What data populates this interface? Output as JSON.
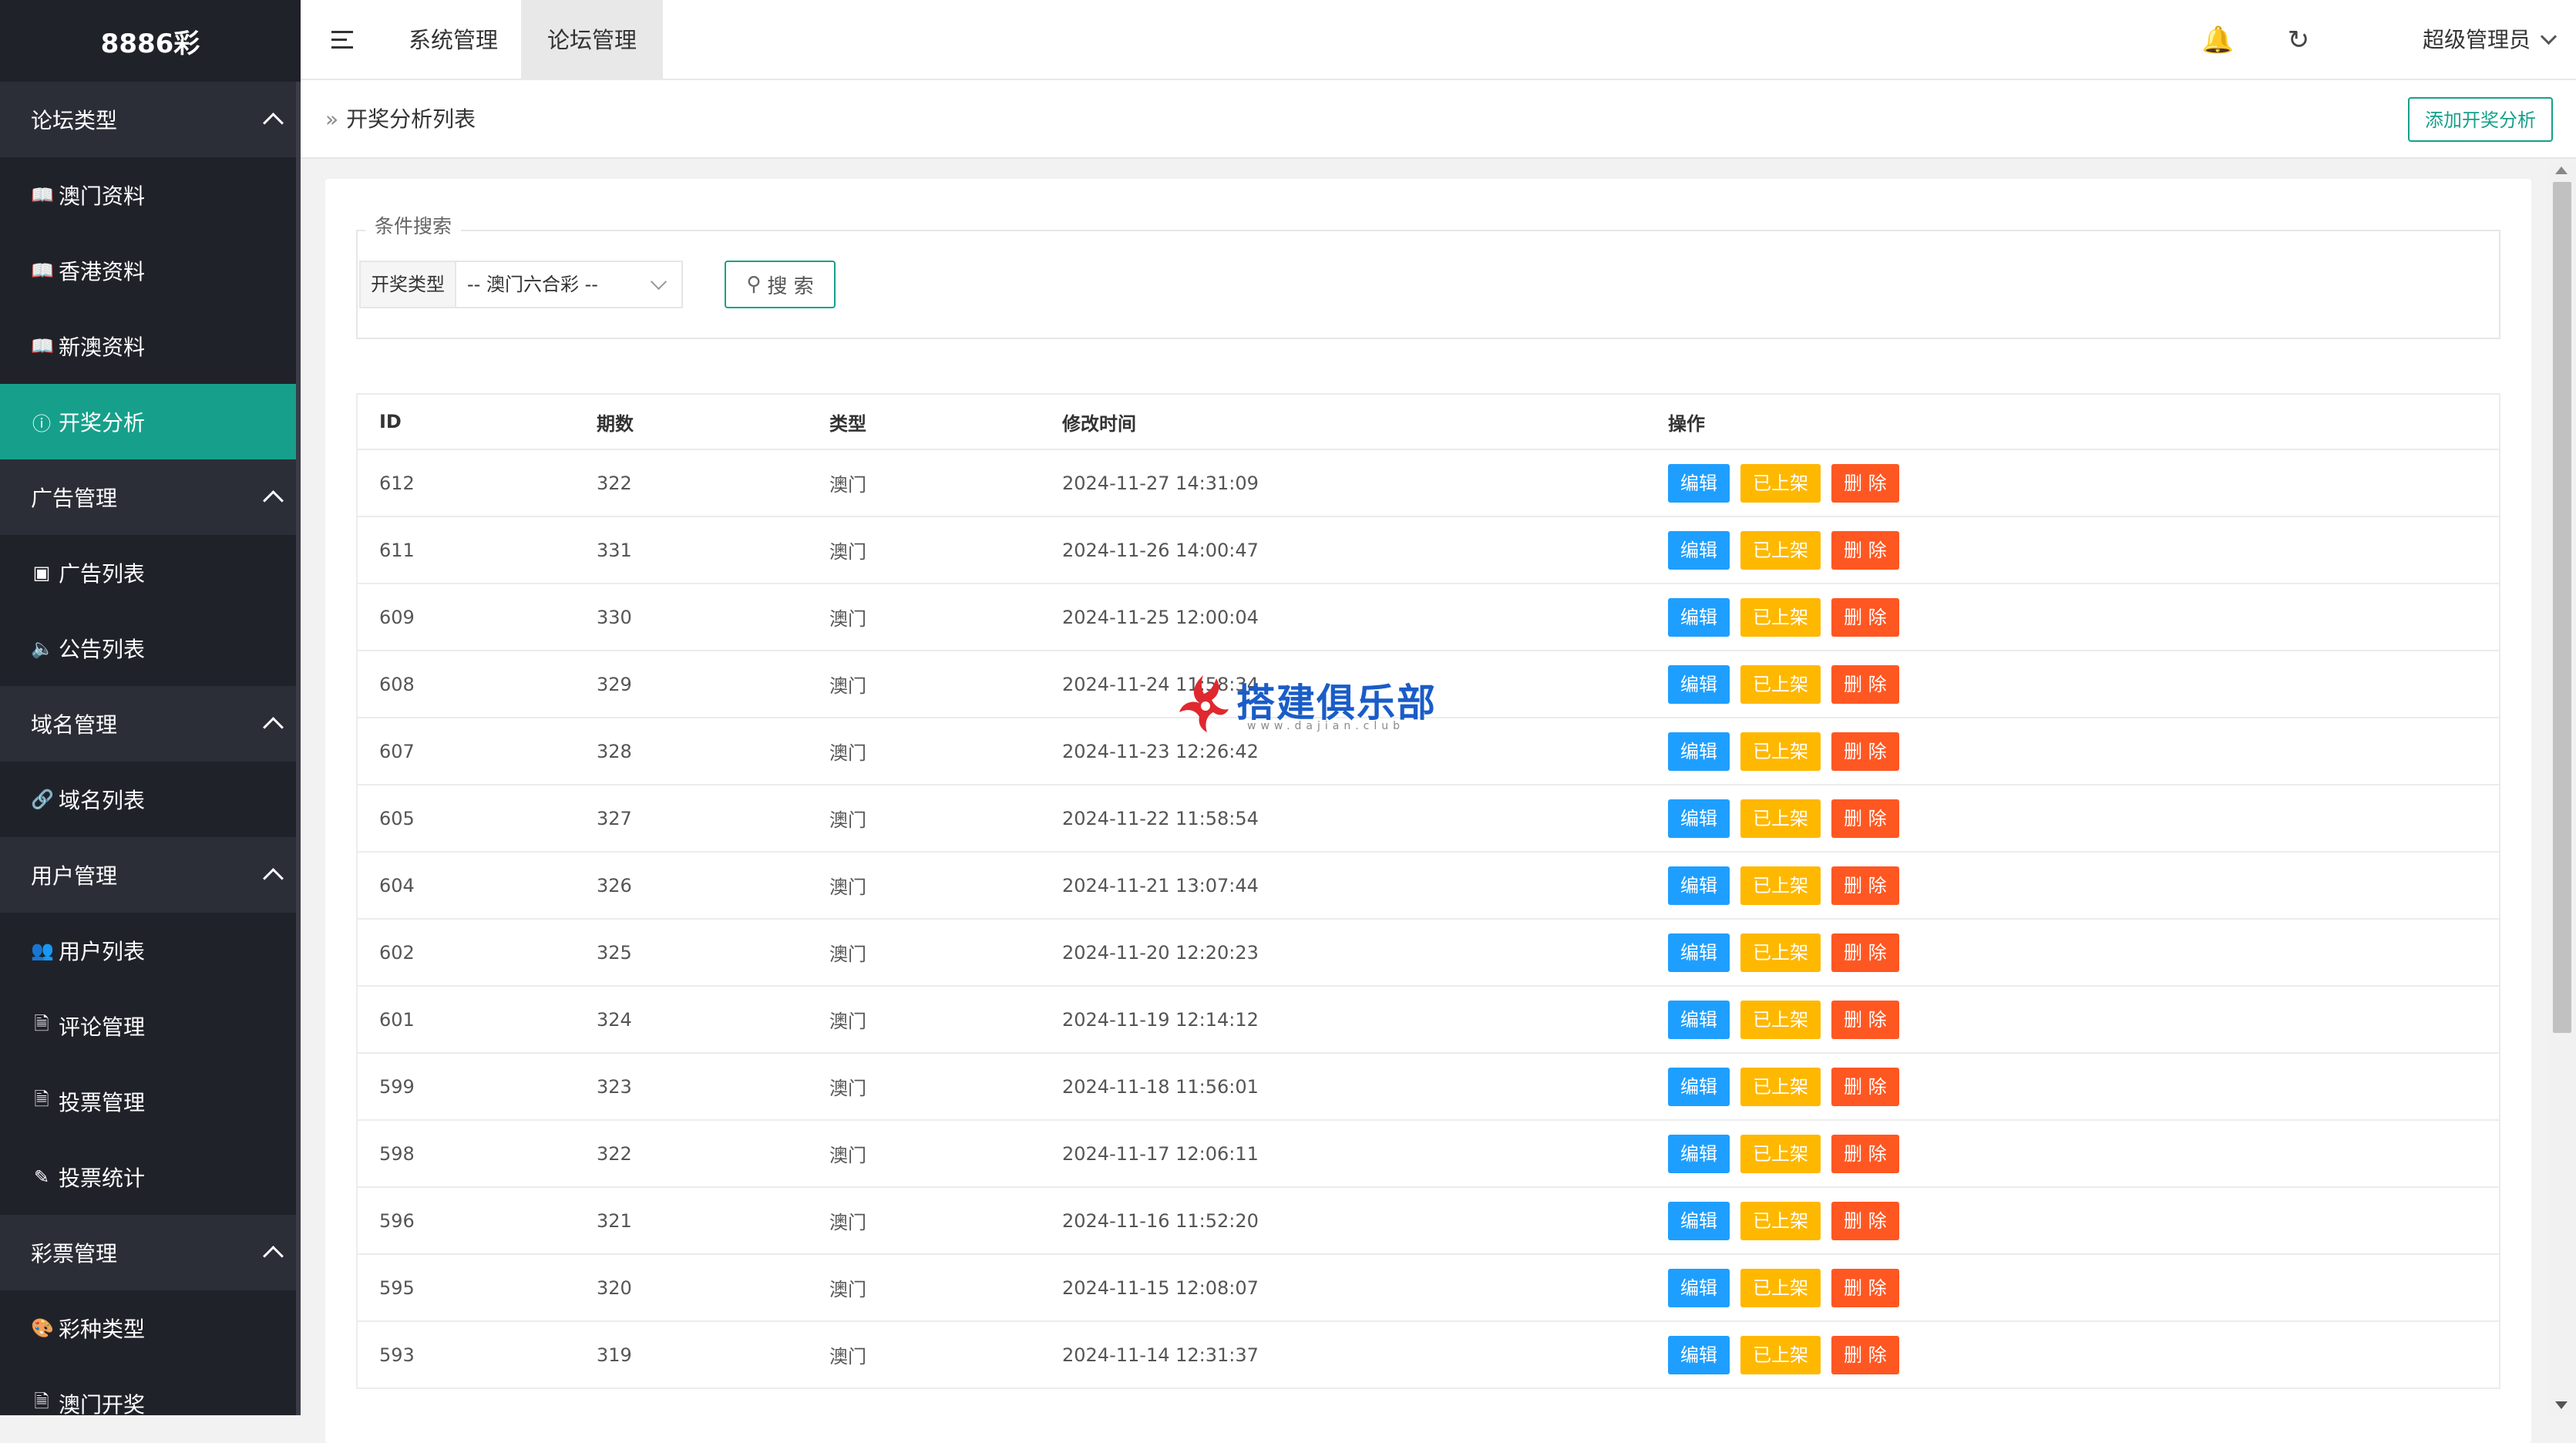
{
  "sidebar": {
    "brand": "8886彩",
    "sections": [
      {
        "label": "论坛类型",
        "items": [
          {
            "label": "澳门资料",
            "icon": "book-icon"
          },
          {
            "label": "香港资料",
            "icon": "book-icon"
          },
          {
            "label": "新澳资料",
            "icon": "book-icon"
          },
          {
            "label": "开奖分析",
            "icon": "help-circle-icon",
            "active": true
          }
        ]
      },
      {
        "label": "广告管理",
        "items": [
          {
            "label": "广告列表",
            "icon": "picture-icon"
          },
          {
            "label": "公告列表",
            "icon": "speaker-icon"
          }
        ]
      },
      {
        "label": "域名管理",
        "items": [
          {
            "label": "域名列表",
            "icon": "link-icon"
          }
        ]
      },
      {
        "label": "用户管理",
        "items": [
          {
            "label": "用户列表",
            "icon": "users-icon"
          },
          {
            "label": "评论管理",
            "icon": "document-icon"
          },
          {
            "label": "投票管理",
            "icon": "document-icon"
          },
          {
            "label": "投票统计",
            "icon": "edit-document-icon"
          }
        ]
      },
      {
        "label": "彩票管理",
        "items": [
          {
            "label": "彩种类型",
            "icon": "palette-icon"
          },
          {
            "label": "澳门开奖",
            "icon": "document-icon"
          }
        ]
      }
    ]
  },
  "header": {
    "tabs": [
      {
        "label": "系统管理",
        "active": false
      },
      {
        "label": "论坛管理",
        "active": true
      }
    ],
    "user": "超级管理员"
  },
  "breadcrumb": {
    "current": "开奖分析列表"
  },
  "add_button": "添加开奖分析",
  "search": {
    "legend": "条件搜索",
    "select_label": "开奖类型",
    "select_value": "-- 澳门六合彩 --",
    "button": "搜 索"
  },
  "table": {
    "headers": {
      "id": "ID",
      "qs": "期数",
      "type": "类型",
      "time": "修改时间",
      "ops": "操作"
    },
    "actions": {
      "edit": "编辑",
      "shelf": "已上架",
      "delete": "删 除"
    },
    "rows": [
      {
        "id": "612",
        "qs": "322",
        "type": "澳门",
        "time": "2024-11-27 14:31:09"
      },
      {
        "id": "611",
        "qs": "331",
        "type": "澳门",
        "time": "2024-11-26 14:00:47"
      },
      {
        "id": "609",
        "qs": "330",
        "type": "澳门",
        "time": "2024-11-25 12:00:04"
      },
      {
        "id": "608",
        "qs": "329",
        "type": "澳门",
        "time": "2024-11-24 11:58:34"
      },
      {
        "id": "607",
        "qs": "328",
        "type": "澳门",
        "time": "2024-11-23 12:26:42"
      },
      {
        "id": "605",
        "qs": "327",
        "type": "澳门",
        "time": "2024-11-22 11:58:54"
      },
      {
        "id": "604",
        "qs": "326",
        "type": "澳门",
        "time": "2024-11-21 13:07:44"
      },
      {
        "id": "602",
        "qs": "325",
        "type": "澳门",
        "time": "2024-11-20 12:20:23"
      },
      {
        "id": "601",
        "qs": "324",
        "type": "澳门",
        "time": "2024-11-19 12:14:12"
      },
      {
        "id": "599",
        "qs": "323",
        "type": "澳门",
        "time": "2024-11-18 11:56:01"
      },
      {
        "id": "598",
        "qs": "322",
        "type": "澳门",
        "time": "2024-11-17 12:06:11"
      },
      {
        "id": "596",
        "qs": "321",
        "type": "澳门",
        "time": "2024-11-16 11:52:20"
      },
      {
        "id": "595",
        "qs": "320",
        "type": "澳门",
        "time": "2024-11-15 12:08:07"
      },
      {
        "id": "593",
        "qs": "319",
        "type": "澳门",
        "time": "2024-11-14 12:31:37"
      }
    ]
  },
  "watermark": {
    "title": "搭建俱乐部",
    "url": "www.dajian.club"
  },
  "colors": {
    "accent": "#16a08b",
    "edit": "#1e9fff",
    "shelf": "#ffb800",
    "delete": "#ff5722",
    "sidebar": "#20222a"
  }
}
